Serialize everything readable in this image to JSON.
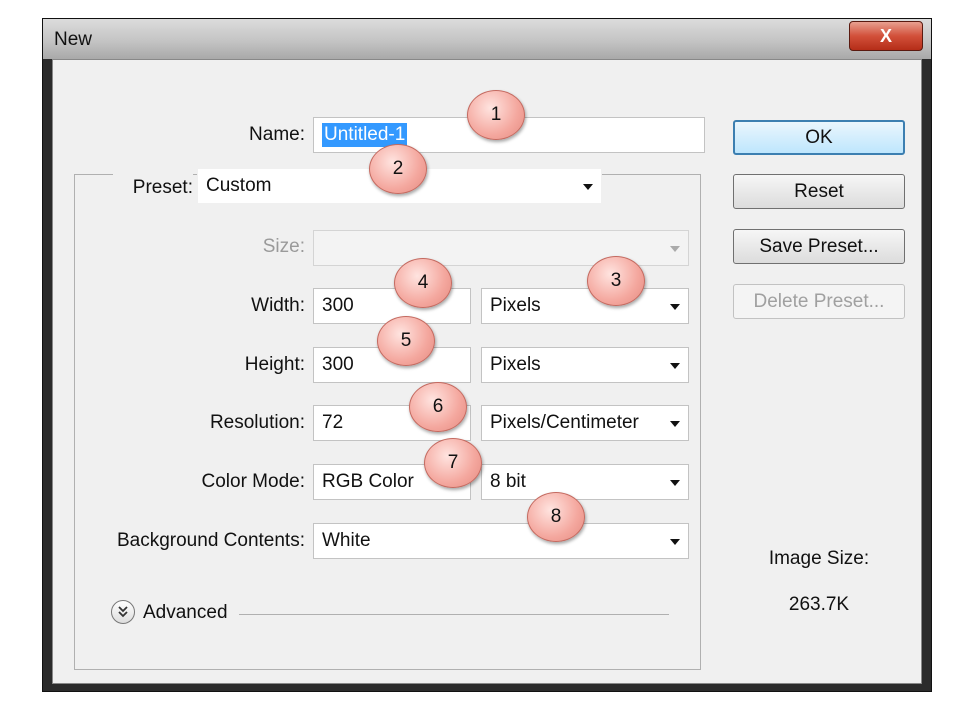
{
  "window": {
    "title": "New",
    "close_glyph": "X"
  },
  "form": {
    "name_label": "Name:",
    "name_value": "Untitled-1",
    "preset_label": "Preset:",
    "preset_value": "Custom",
    "size_label": "Size:",
    "size_value": "",
    "width_label": "Width:",
    "width_value": "300",
    "width_unit": "Pixels",
    "height_label": "Height:",
    "height_value": "300",
    "height_unit": "Pixels",
    "resolution_label": "Resolution:",
    "resolution_value": "72",
    "resolution_unit": "Pixels/Centimeter",
    "color_mode_label": "Color Mode:",
    "color_mode_value": "RGB Color",
    "bit_depth_value": "8 bit",
    "background_label": "Background Contents:",
    "background_value": "White",
    "advanced_label": "Advanced"
  },
  "buttons": {
    "ok": "OK",
    "reset": "Reset",
    "save_preset": "Save Preset...",
    "delete_preset": "Delete Preset..."
  },
  "image_info": {
    "label": "Image Size:",
    "value": "263.7K"
  },
  "callouts": [
    "1",
    "2",
    "3",
    "4",
    "5",
    "6",
    "7",
    "8"
  ],
  "colors": {
    "selection": "#3399ff",
    "callout_fill": "#f4a79e",
    "close_button": "#d2503a"
  },
  "icons": {
    "close": "close-icon",
    "dropdown": "chevron-down-icon",
    "advanced": "double-chevron-down-icon"
  }
}
